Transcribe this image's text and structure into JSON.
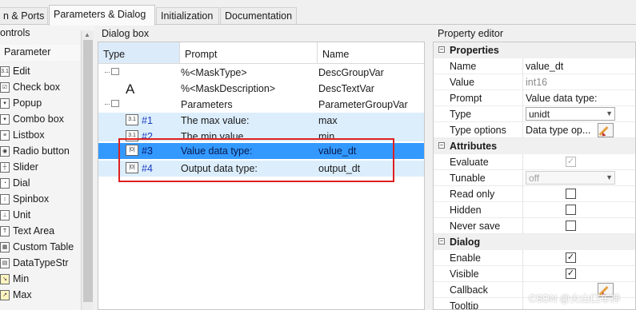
{
  "tabs": [
    "n & Ports",
    "Parameters & Dialog",
    "Initialization",
    "Documentation"
  ],
  "controls": {
    "title": "ontrols",
    "parameter_label": "Parameter",
    "items": [
      {
        "label": "Edit",
        "icon": "edit-icon"
      },
      {
        "label": "Check box",
        "icon": "checkbox-icon"
      },
      {
        "label": "Popup",
        "icon": "popup-icon"
      },
      {
        "label": "Combo box",
        "icon": "combobox-icon"
      },
      {
        "label": "Listbox",
        "icon": "listbox-icon"
      },
      {
        "label": "Radio button",
        "icon": "radio-icon"
      },
      {
        "label": "Slider",
        "icon": "slider-icon"
      },
      {
        "label": "Dial",
        "icon": "dial-icon"
      },
      {
        "label": "Spinbox",
        "icon": "spinbox-icon"
      },
      {
        "label": "Unit",
        "icon": "unit-icon"
      },
      {
        "label": "Text Area",
        "icon": "textarea-icon"
      },
      {
        "label": "Custom Table",
        "icon": "table-icon"
      },
      {
        "label": "DataTypeStr",
        "icon": "datatype-icon"
      },
      {
        "label": "Min",
        "icon": "min-icon"
      },
      {
        "label": "Max",
        "icon": "max-icon"
      }
    ]
  },
  "dialog": {
    "title": "Dialog box",
    "columns": [
      "Type",
      "Prompt",
      "Name"
    ],
    "rows": [
      {
        "num": "",
        "prompt": "%<MaskType>",
        "name": "DescGroupVar"
      },
      {
        "num": "",
        "prompt": "%<MaskDescription>",
        "name": "DescTextVar",
        "type_glyph": "A"
      },
      {
        "num": "",
        "prompt": "Parameters",
        "name": "ParameterGroupVar"
      },
      {
        "num": "#1",
        "prompt": "The max value:",
        "name": "max"
      },
      {
        "num": "#2",
        "prompt": "The min value",
        "name": "min"
      },
      {
        "num": "#3",
        "prompt": "Value data type:",
        "name": "value_dt"
      },
      {
        "num": "#4",
        "prompt": "Output data type:",
        "name": "output_dt"
      }
    ]
  },
  "property_editor": {
    "title": "Property editor",
    "sections": {
      "properties": "Properties",
      "attributes": "Attributes",
      "dialog": "Dialog"
    },
    "properties": {
      "name": {
        "key": "Name",
        "value": "value_dt"
      },
      "value": {
        "key": "Value",
        "value": "int16"
      },
      "prompt": {
        "key": "Prompt",
        "value": "Value data type:"
      },
      "type": {
        "key": "Type",
        "value": "unidt"
      },
      "type_options": {
        "key": "Type options",
        "value": "Data type op..."
      }
    },
    "attributes": {
      "evaluate": {
        "key": "Evaluate",
        "checked": true
      },
      "tunable": {
        "key": "Tunable",
        "value": "off"
      },
      "read_only": {
        "key": "Read only",
        "checked": false
      },
      "hidden": {
        "key": "Hidden",
        "checked": false
      },
      "never_save": {
        "key": "Never save",
        "checked": false
      }
    },
    "dialog": {
      "enable": {
        "key": "Enable",
        "checked": true
      },
      "visible": {
        "key": "Visible",
        "checked": true
      },
      "callback": {
        "key": "Callback"
      },
      "tooltip": {
        "key": "Tooltip"
      }
    }
  },
  "check_glyph": "✓",
  "watermark": "CSDN @火山口车神",
  "colors": {
    "selection": "#3399ff",
    "highlight_box": "#e02020",
    "row_highlight": "#dceefc"
  }
}
